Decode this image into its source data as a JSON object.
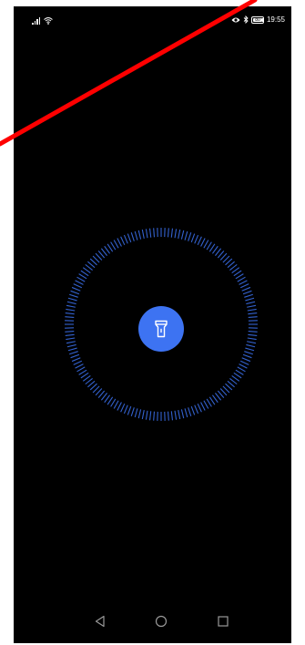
{
  "status_bar": {
    "time": "19:55",
    "battery_level": "80",
    "icons": [
      "signal-icon",
      "wifi-icon",
      "eye-icon",
      "bluetooth-icon",
      "battery-icon"
    ]
  },
  "flashlight": {
    "button_icon": "flashlight-icon",
    "accent_color": "#3d73f2",
    "ring_color": "#3d73f2",
    "state": "off"
  },
  "navigation": {
    "icons": [
      "back-icon",
      "home-icon",
      "recents-icon"
    ]
  },
  "colors": {
    "background": "#000000",
    "annotation_line": "#ff0000"
  }
}
